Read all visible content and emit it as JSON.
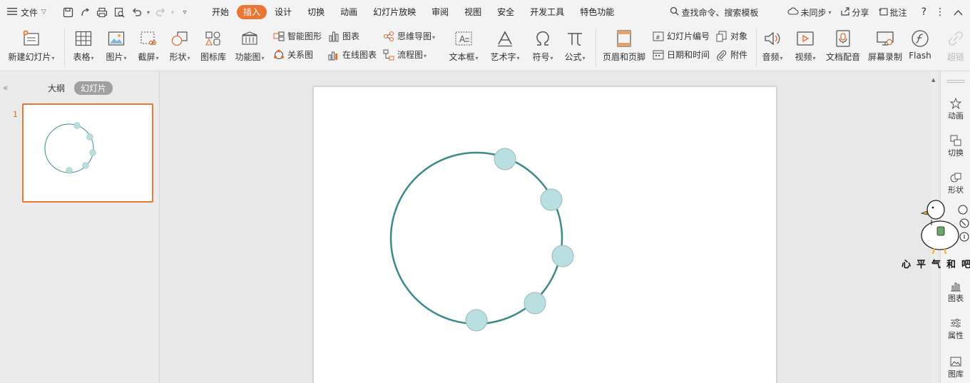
{
  "menubar": {
    "file_label": "文件",
    "tabs": [
      "开始",
      "插入",
      "设计",
      "切换",
      "动画",
      "幻灯片放映",
      "审阅",
      "视图",
      "安全",
      "开发工具",
      "特色功能"
    ],
    "active_tab": "插入",
    "search_label": "查找命令、搜索模板",
    "sync_label": "未同步",
    "share_label": "分享",
    "comment_label": "批注"
  },
  "ribbon": {
    "new_slide": "新建幻灯片",
    "table": "表格",
    "picture": "图片",
    "screenshot": "截屏",
    "shape": "形状",
    "icon_lib": "图标库",
    "func_chart": "功能图",
    "smart_art": "智能图形",
    "relation": "关系图",
    "chart": "图表",
    "online_chart": "在线图表",
    "mindmap": "思维导图",
    "flowchart": "流程图",
    "textbox": "文本框",
    "wordart": "艺术字",
    "symbol": "符号",
    "formula": "公式",
    "header_footer": "页眉和页脚",
    "slide_number": "幻灯片编号",
    "date_time": "日期和时间",
    "object": "对象",
    "attachment": "附件",
    "audio": "音频",
    "video": "视频",
    "doc_dub": "文档配音",
    "screen_record": "屏幕录制",
    "flash": "Flash",
    "hyperlink_partial": "超链"
  },
  "leftpanel": {
    "outline_tab": "大纲",
    "slides_tab": "幻灯片",
    "slide_number": "1"
  },
  "rightrail": {
    "animation": "动画",
    "transition": "切换",
    "shape": "形状",
    "chart": "图表",
    "property": "属性",
    "library": "图库"
  },
  "watermark": {
    "text": "心平气和吧"
  },
  "colors": {
    "accent": "#ea7633",
    "circle_stroke": "#3b8a88",
    "dot_fill": "#b9dfe0",
    "dot_stroke": "#9ab9bc"
  }
}
